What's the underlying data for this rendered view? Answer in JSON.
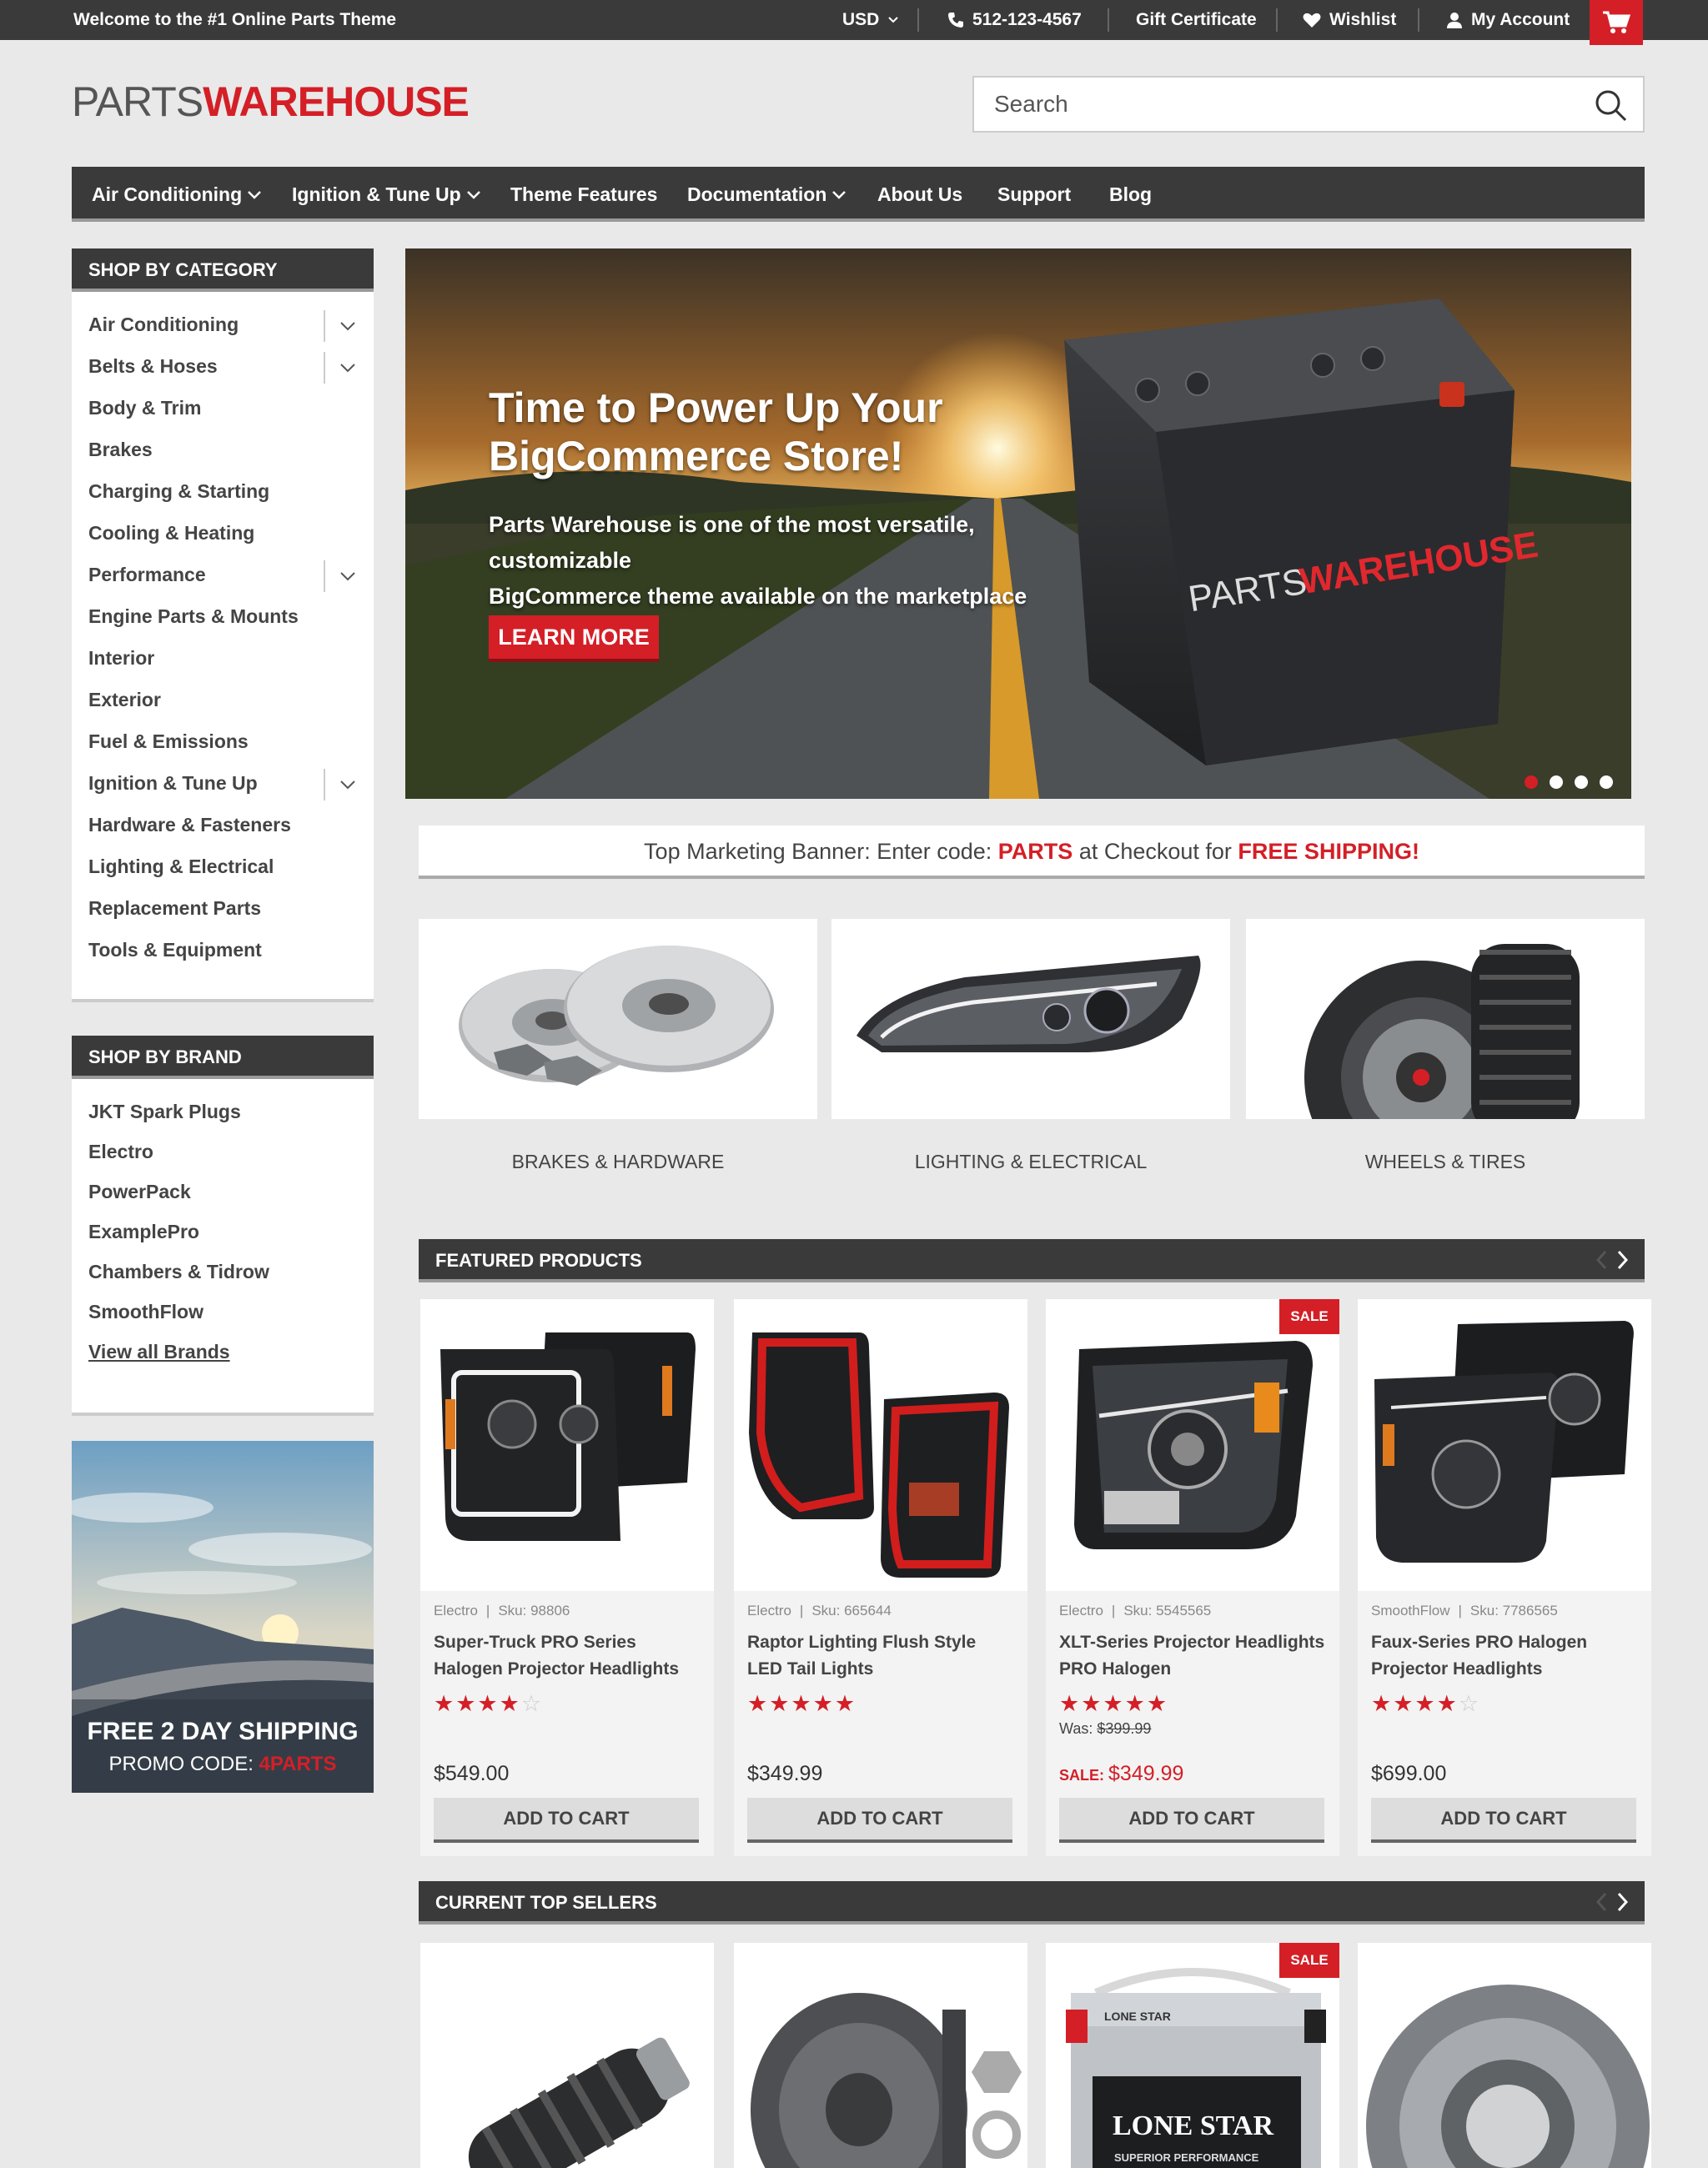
{
  "topbar": {
    "welcome": "Welcome to the #1 Online Parts Theme",
    "currency": "USD",
    "phone": "512-123-4567",
    "gift": "Gift Certificate",
    "wishlist": "Wishlist",
    "account": "My Account"
  },
  "logo": {
    "part1": "PARTS",
    "part2": "WAREHOUSE"
  },
  "search": {
    "placeholder": "Search"
  },
  "nav": [
    {
      "label": "Air Conditioning",
      "dropdown": true
    },
    {
      "label": "Ignition & Tune Up",
      "dropdown": true
    },
    {
      "label": "Theme Features",
      "dropdown": false
    },
    {
      "label": "Documentation",
      "dropdown": true
    },
    {
      "label": "About Us",
      "dropdown": false
    },
    {
      "label": "Support",
      "dropdown": false
    },
    {
      "label": "Blog",
      "dropdown": false
    }
  ],
  "categories": {
    "title": "SHOP BY CATEGORY",
    "items": [
      {
        "label": "Air Conditioning",
        "expand": true
      },
      {
        "label": "Belts & Hoses",
        "expand": true
      },
      {
        "label": "Body & Trim",
        "expand": false
      },
      {
        "label": "Brakes",
        "expand": false
      },
      {
        "label": "Charging & Starting",
        "expand": false
      },
      {
        "label": "Cooling & Heating",
        "expand": false
      },
      {
        "label": "Performance",
        "expand": true
      },
      {
        "label": "Engine Parts & Mounts",
        "expand": false
      },
      {
        "label": "Interior",
        "expand": false
      },
      {
        "label": "Exterior",
        "expand": false
      },
      {
        "label": "Fuel & Emissions",
        "expand": false
      },
      {
        "label": "Ignition & Tune Up",
        "expand": true
      },
      {
        "label": "Hardware & Fasteners",
        "expand": false
      },
      {
        "label": "Lighting & Electrical",
        "expand": false
      },
      {
        "label": "Replacement Parts",
        "expand": false
      },
      {
        "label": "Tools & Equipment",
        "expand": false
      }
    ]
  },
  "brands": {
    "title": "SHOP BY BRAND",
    "items": [
      "JKT Spark Plugs",
      "Electro",
      "PowerPack",
      "ExamplePro",
      "Chambers & Tidrow",
      "SmoothFlow"
    ],
    "view_all": "View all Brands"
  },
  "promo": {
    "line1": "FREE 2 DAY SHIPPING",
    "line2": "PROMO CODE: ",
    "code": "4PARTS"
  },
  "hero": {
    "title_line1": "Time to Power Up Your",
    "title_line2": "BigCommerce Store!",
    "subtitle_line1": "Parts Warehouse is one of the most versatile, customizable",
    "subtitle_line2": "BigCommerce theme available on the marketplace",
    "cta": "LEARN MORE",
    "battery_logo1": "PARTS",
    "battery_logo2": "WAREHOUSE"
  },
  "marketing": {
    "prefix": "Top Marketing Banner: Enter code: ",
    "code": "PARTS",
    "mid": " at Checkout for ",
    "offer": "FREE SHIPPING!"
  },
  "tiles": [
    "BRAKES & HARDWARE",
    "LIGHTING & ELECTRICAL",
    "WHEELS & TIRES"
  ],
  "featured": {
    "title": "FEATURED PRODUCTS",
    "products": [
      {
        "brand": "Electro",
        "sku": "Sku: 98806",
        "name": "Super-Truck PRO Series Halogen Projector Headlights",
        "stars": 4,
        "price": "$549.00",
        "cta": "ADD TO CART"
      },
      {
        "brand": "Electro",
        "sku": "Sku: 665644",
        "name": "Raptor Lighting Flush Style LED Tail Lights",
        "stars": 5,
        "price": "$349.99",
        "cta": "ADD TO CART"
      },
      {
        "brand": "Electro",
        "sku": "Sku: 5545565",
        "name": "XLT-Series Projector Headlights PRO Halogen",
        "stars": 5,
        "was_label": "Was: ",
        "was_price": "$399.99",
        "sale_label": "SALE: ",
        "price": "$349.99",
        "badge": "SALE",
        "cta": "ADD TO CART"
      },
      {
        "brand": "SmoothFlow",
        "sku": "Sku: 7786565",
        "name": "Faux-Series PRO Halogen Projector Headlights",
        "stars": 4,
        "price": "$699.00",
        "cta": "ADD TO CART"
      }
    ]
  },
  "topsellers": {
    "title": "CURRENT TOP SELLERS",
    "badge": "SALE",
    "battery_label": "LONE STAR",
    "battery_sub": "SUPERIOR PERFORMANCE",
    "battery_top": "LONE STAR"
  },
  "colors": {
    "accent": "#d41f27",
    "dark": "#3a3a3a",
    "bg": "#e9e9e9"
  }
}
